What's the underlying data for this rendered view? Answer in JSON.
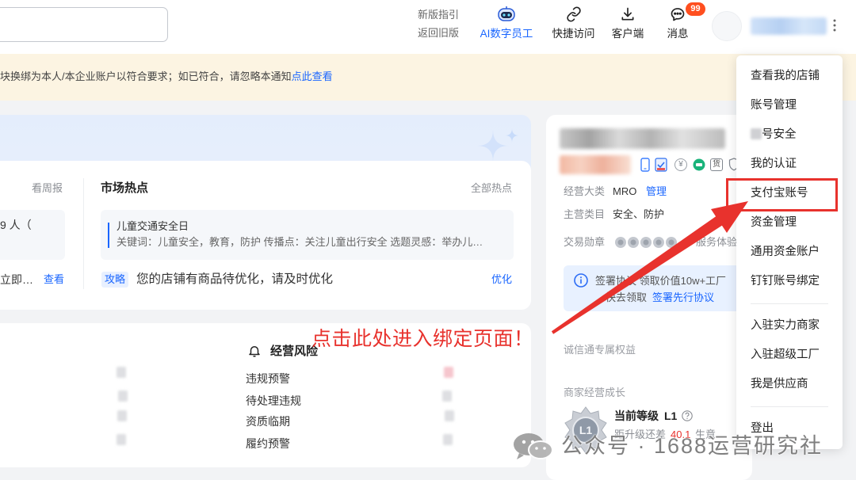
{
  "header": {
    "guide_label": "新版指引",
    "old_version_label": "返回旧版",
    "nav": [
      {
        "icon": "robot-icon",
        "label": "AI数字员工"
      },
      {
        "icon": "link-icon",
        "label": "快捷访问"
      },
      {
        "icon": "download-icon",
        "label": "客户端"
      },
      {
        "icon": "message-icon",
        "label": "消息",
        "badge": "99"
      }
    ],
    "more_icon": "more-vertical-icon"
  },
  "notice": {
    "text": "块换绑为本人/本企业账户以符合要求；如已符合，请忽略本通知",
    "link": "点此查看"
  },
  "weekly": {
    "link": "看周报",
    "stat": "9 人（",
    "action_text": "立即…",
    "action_link": "查看"
  },
  "hot_topics": {
    "title": "市场热点",
    "all_link": "全部热点",
    "topic": {
      "title": "儿童交通安全日",
      "description": "关键词：儿童安全，教育，防护 传播点：关注儿童出行安全 选题灵感：举办儿…"
    },
    "tip": {
      "tag": "攻略",
      "text": "您的店铺有商品待优化，请及时优化",
      "link": "优化"
    }
  },
  "risk": {
    "icon": "bell-icon",
    "title": "经营风险",
    "items": [
      "违规预警",
      "待处理违规",
      "资质临期",
      "履约预警"
    ]
  },
  "annotation": {
    "text": "点击此处进入绑定页面！"
  },
  "shop_panel": {
    "badge_symbols": {
      "yen": "¥",
      "goods": "货"
    },
    "category": {
      "label": "经营大类",
      "value": "MRO",
      "link": "管理"
    },
    "main_category": {
      "label": "主营类目",
      "value": "安全、防护"
    },
    "medals": {
      "label": "交易勋章",
      "service_label": "服务体验"
    },
    "promo": {
      "icon": "info-icon",
      "line1": "签署协议 领取价值10w+工厂",
      "line2": "快去领取",
      "link": "签署先行协议"
    },
    "benefits_label": "诚信通专属权益",
    "growth": {
      "label": "商家经营成长",
      "medal_text": "L1",
      "level_label": "当前等级",
      "level": "L1",
      "help_icon": "question-icon",
      "upgrade_prefix": "距升级还差",
      "upgrade_value": "40.1",
      "upgrade_suffix": "生意"
    }
  },
  "account_menu": {
    "items": [
      "查看我的店铺",
      "账号管理",
      "号安全",
      "我的认证",
      "支付宝账号",
      "资金管理",
      "通用资金账户",
      "钉钉账号绑定",
      "入驻实力商家",
      "入驻超级工厂",
      "我是供应商",
      "登出"
    ],
    "highlighted_index": 4
  },
  "watermark": {
    "icon": "wechat-icon",
    "text": "公众号 · 1688运营研究社"
  },
  "colors": {
    "accent": "#1a66ff",
    "annotation_red": "#e8322d",
    "badge": "#ff4f1f",
    "notice_bg": "#fcf4e2",
    "page_bg": "#f2f3f5"
  }
}
